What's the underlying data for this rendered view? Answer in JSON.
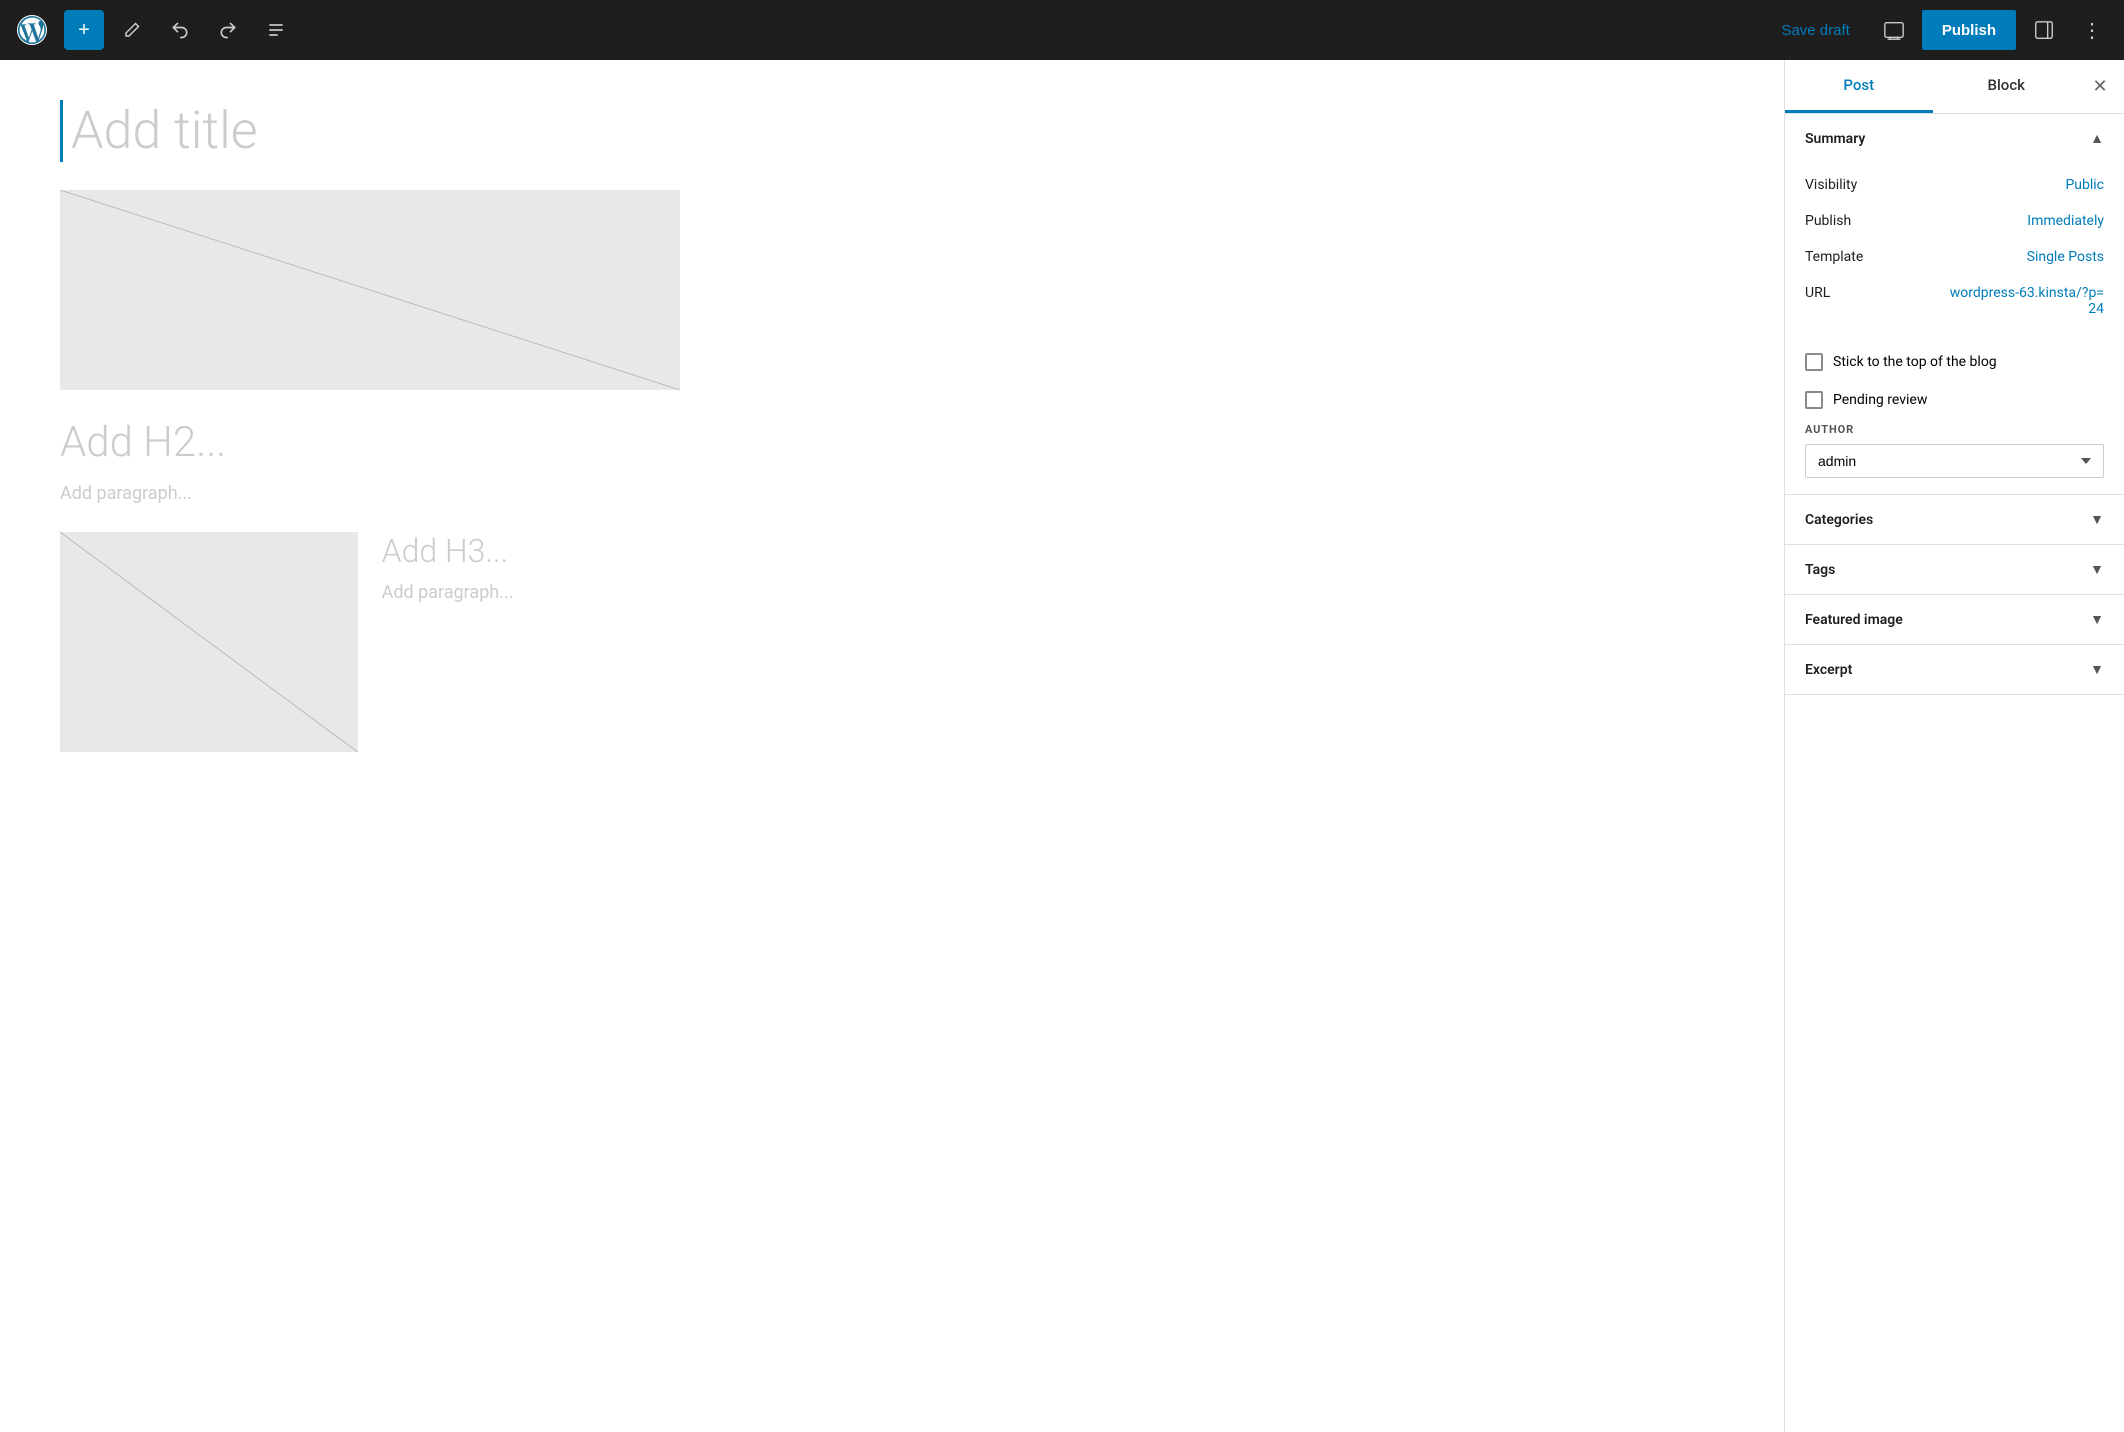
{
  "topbar": {
    "add_label": "+",
    "save_draft_label": "Save draft",
    "publish_label": "Publish"
  },
  "editor": {
    "title_placeholder": "Add title",
    "h2_placeholder": "Add H2...",
    "paragraph_placeholder": "Add paragraph...",
    "h3_placeholder": "Add H3...",
    "paragraph2_placeholder": "Add paragraph..."
  },
  "sidebar": {
    "tab_post": "Post",
    "tab_block": "Block",
    "summary_title": "Summary",
    "visibility_label": "Visibility",
    "visibility_value": "Public",
    "publish_label": "Publish",
    "publish_value": "Immediately",
    "template_label": "Template",
    "template_value": "Single Posts",
    "url_label": "URL",
    "url_value": "wordpress-63.kinsta/?p=24",
    "stick_to_top_label": "Stick to the top of the blog",
    "pending_review_label": "Pending review",
    "author_label": "AUTHOR",
    "author_value": "admin",
    "categories_label": "Categories",
    "tags_label": "Tags",
    "featured_image_label": "Featured image",
    "excerpt_label": "Excerpt"
  }
}
